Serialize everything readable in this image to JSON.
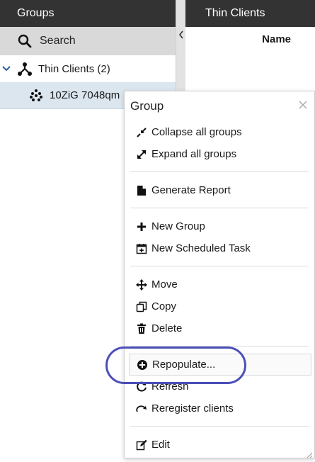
{
  "left_panel": {
    "header": "Groups",
    "search_label": "Search",
    "group_label": "Thin Clients (2)",
    "client_label": "10ZiG 7048qm"
  },
  "right_panel": {
    "header": "Thin Clients",
    "column_name": "Name"
  },
  "menu": {
    "title": "Group",
    "items": [
      {
        "label": "Collapse all groups",
        "icon": "collapse-icon"
      },
      {
        "label": "Expand all groups",
        "icon": "expand-icon"
      },
      {
        "label": "Generate Report",
        "icon": "document-icon"
      },
      {
        "label": "New Group",
        "icon": "plus-icon"
      },
      {
        "label": "New Scheduled Task",
        "icon": "calendar-plus-icon"
      },
      {
        "label": "Move",
        "icon": "move-icon"
      },
      {
        "label": "Copy",
        "icon": "copy-icon"
      },
      {
        "label": "Delete",
        "icon": "trash-icon"
      },
      {
        "label": "Repopulate...",
        "icon": "plus-circle-icon"
      },
      {
        "label": "Refresh",
        "icon": "refresh-icon"
      },
      {
        "label": "Reregister clients",
        "icon": "redo-icon"
      },
      {
        "label": "Edit",
        "icon": "edit-icon"
      }
    ]
  },
  "colors": {
    "header_bg": "#333333",
    "search_bg": "#d9d9d9",
    "selected_row_bg": "#dbe6ef",
    "annotation": "#4b4fb8"
  }
}
